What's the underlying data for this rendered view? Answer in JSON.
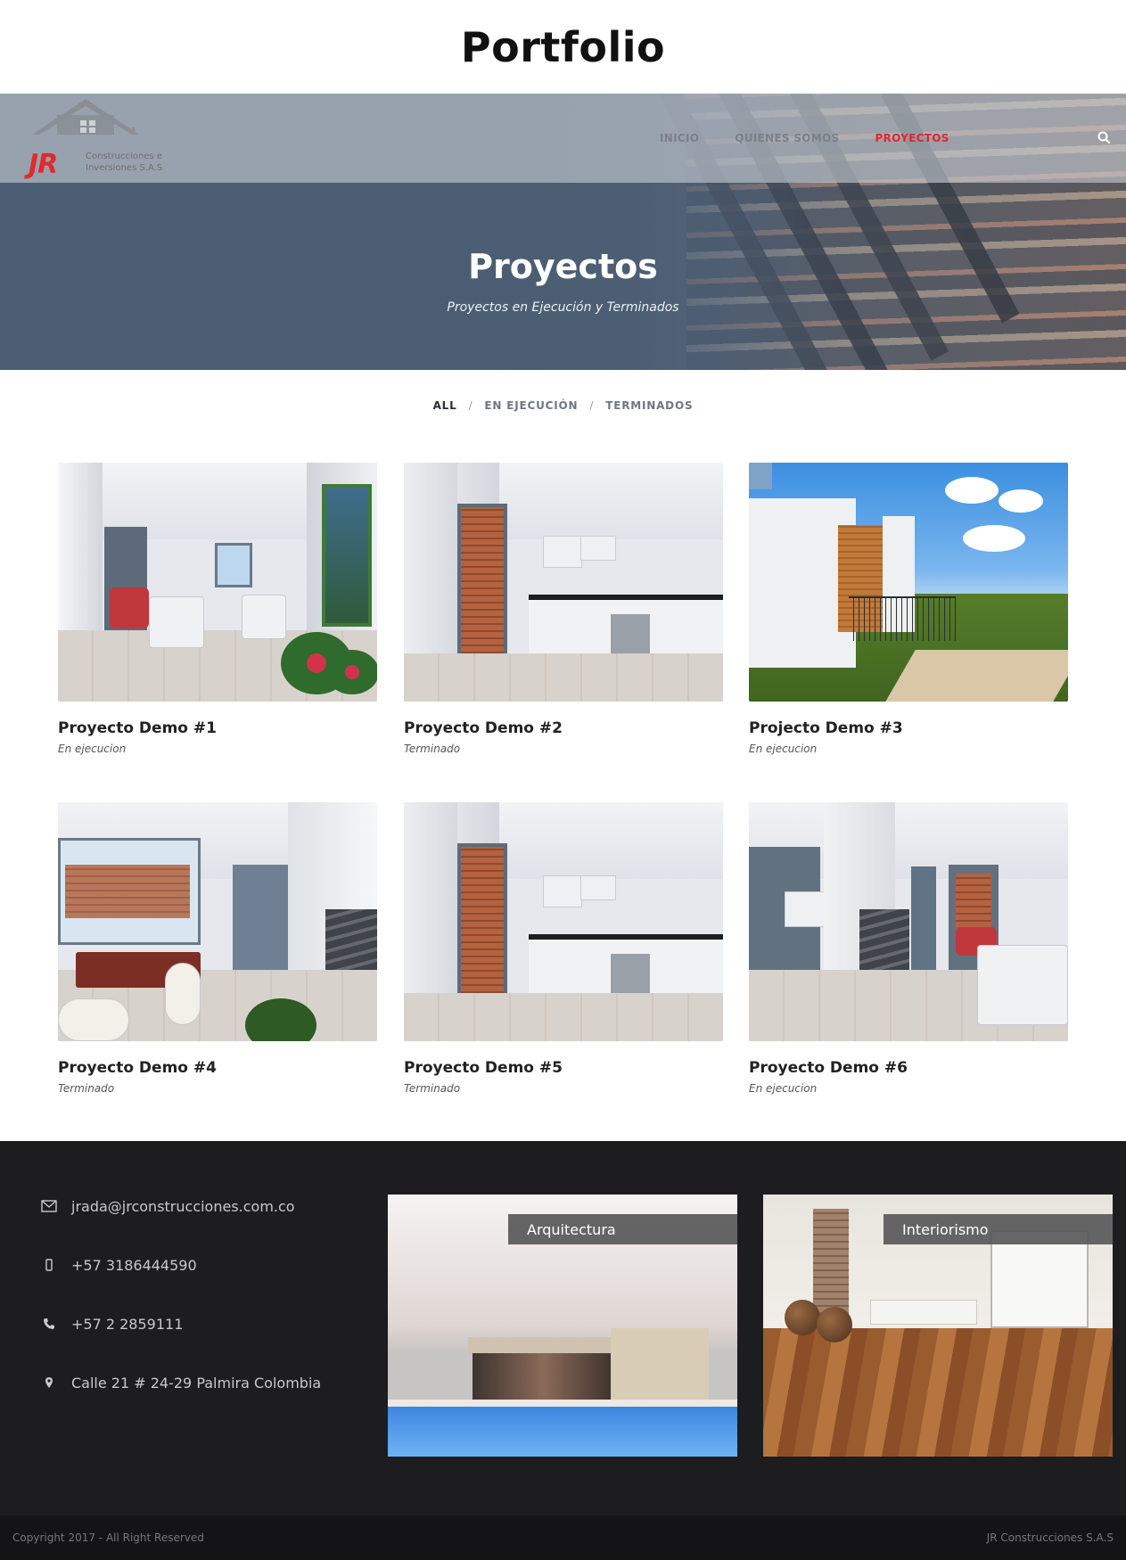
{
  "page": {
    "title": "Portfolio"
  },
  "nav": {
    "logo_text": "JR",
    "logo_sub": "Construcciones e Inversiones S.A.S",
    "links": [
      {
        "label": "INICIO",
        "active": false
      },
      {
        "label": "QUIENES SOMOS",
        "active": false
      },
      {
        "label": "PROYECTOS",
        "active": true
      }
    ],
    "search_icon": "search-icon",
    "active_color": "#e0262d"
  },
  "hero": {
    "title": "Proyectos",
    "subtitle": "Proyectos en Ejecución y Terminados"
  },
  "filters": {
    "items": [
      "ALL",
      "EN EJECUCIÓN",
      "TERMINADOS"
    ],
    "separator": "/",
    "active": "ALL"
  },
  "projects": [
    {
      "title": "Proyecto Demo #1",
      "status": "En ejecucion"
    },
    {
      "title": "Proyecto Demo #2",
      "status": "Terminado"
    },
    {
      "title": "Projecto Demo #3",
      "status": "En ejecucion"
    },
    {
      "title": "Proyecto Demo #4",
      "status": "Terminado"
    },
    {
      "title": "Proyecto Demo #5",
      "status": "Terminado"
    },
    {
      "title": "Proyecto Demo #6",
      "status": "En ejecucion"
    }
  ],
  "footer": {
    "contacts": [
      {
        "icon": "envelope-icon",
        "text": "jrada@jrconstrucciones.com.co"
      },
      {
        "icon": "mobile-phone-icon",
        "text": "+57 3186444590"
      },
      {
        "icon": "phone-icon",
        "text": "+57 2 2859111"
      },
      {
        "icon": "map-marker-icon",
        "text": "Calle 21 # 24-29 Palmira Colombia"
      }
    ],
    "promos": [
      {
        "label": "Arquitectura"
      },
      {
        "label": "Interiorismo"
      }
    ],
    "copyright": "Copyright 2017 - All Right Reserved",
    "company": "JR Construcciones S.A.S"
  }
}
